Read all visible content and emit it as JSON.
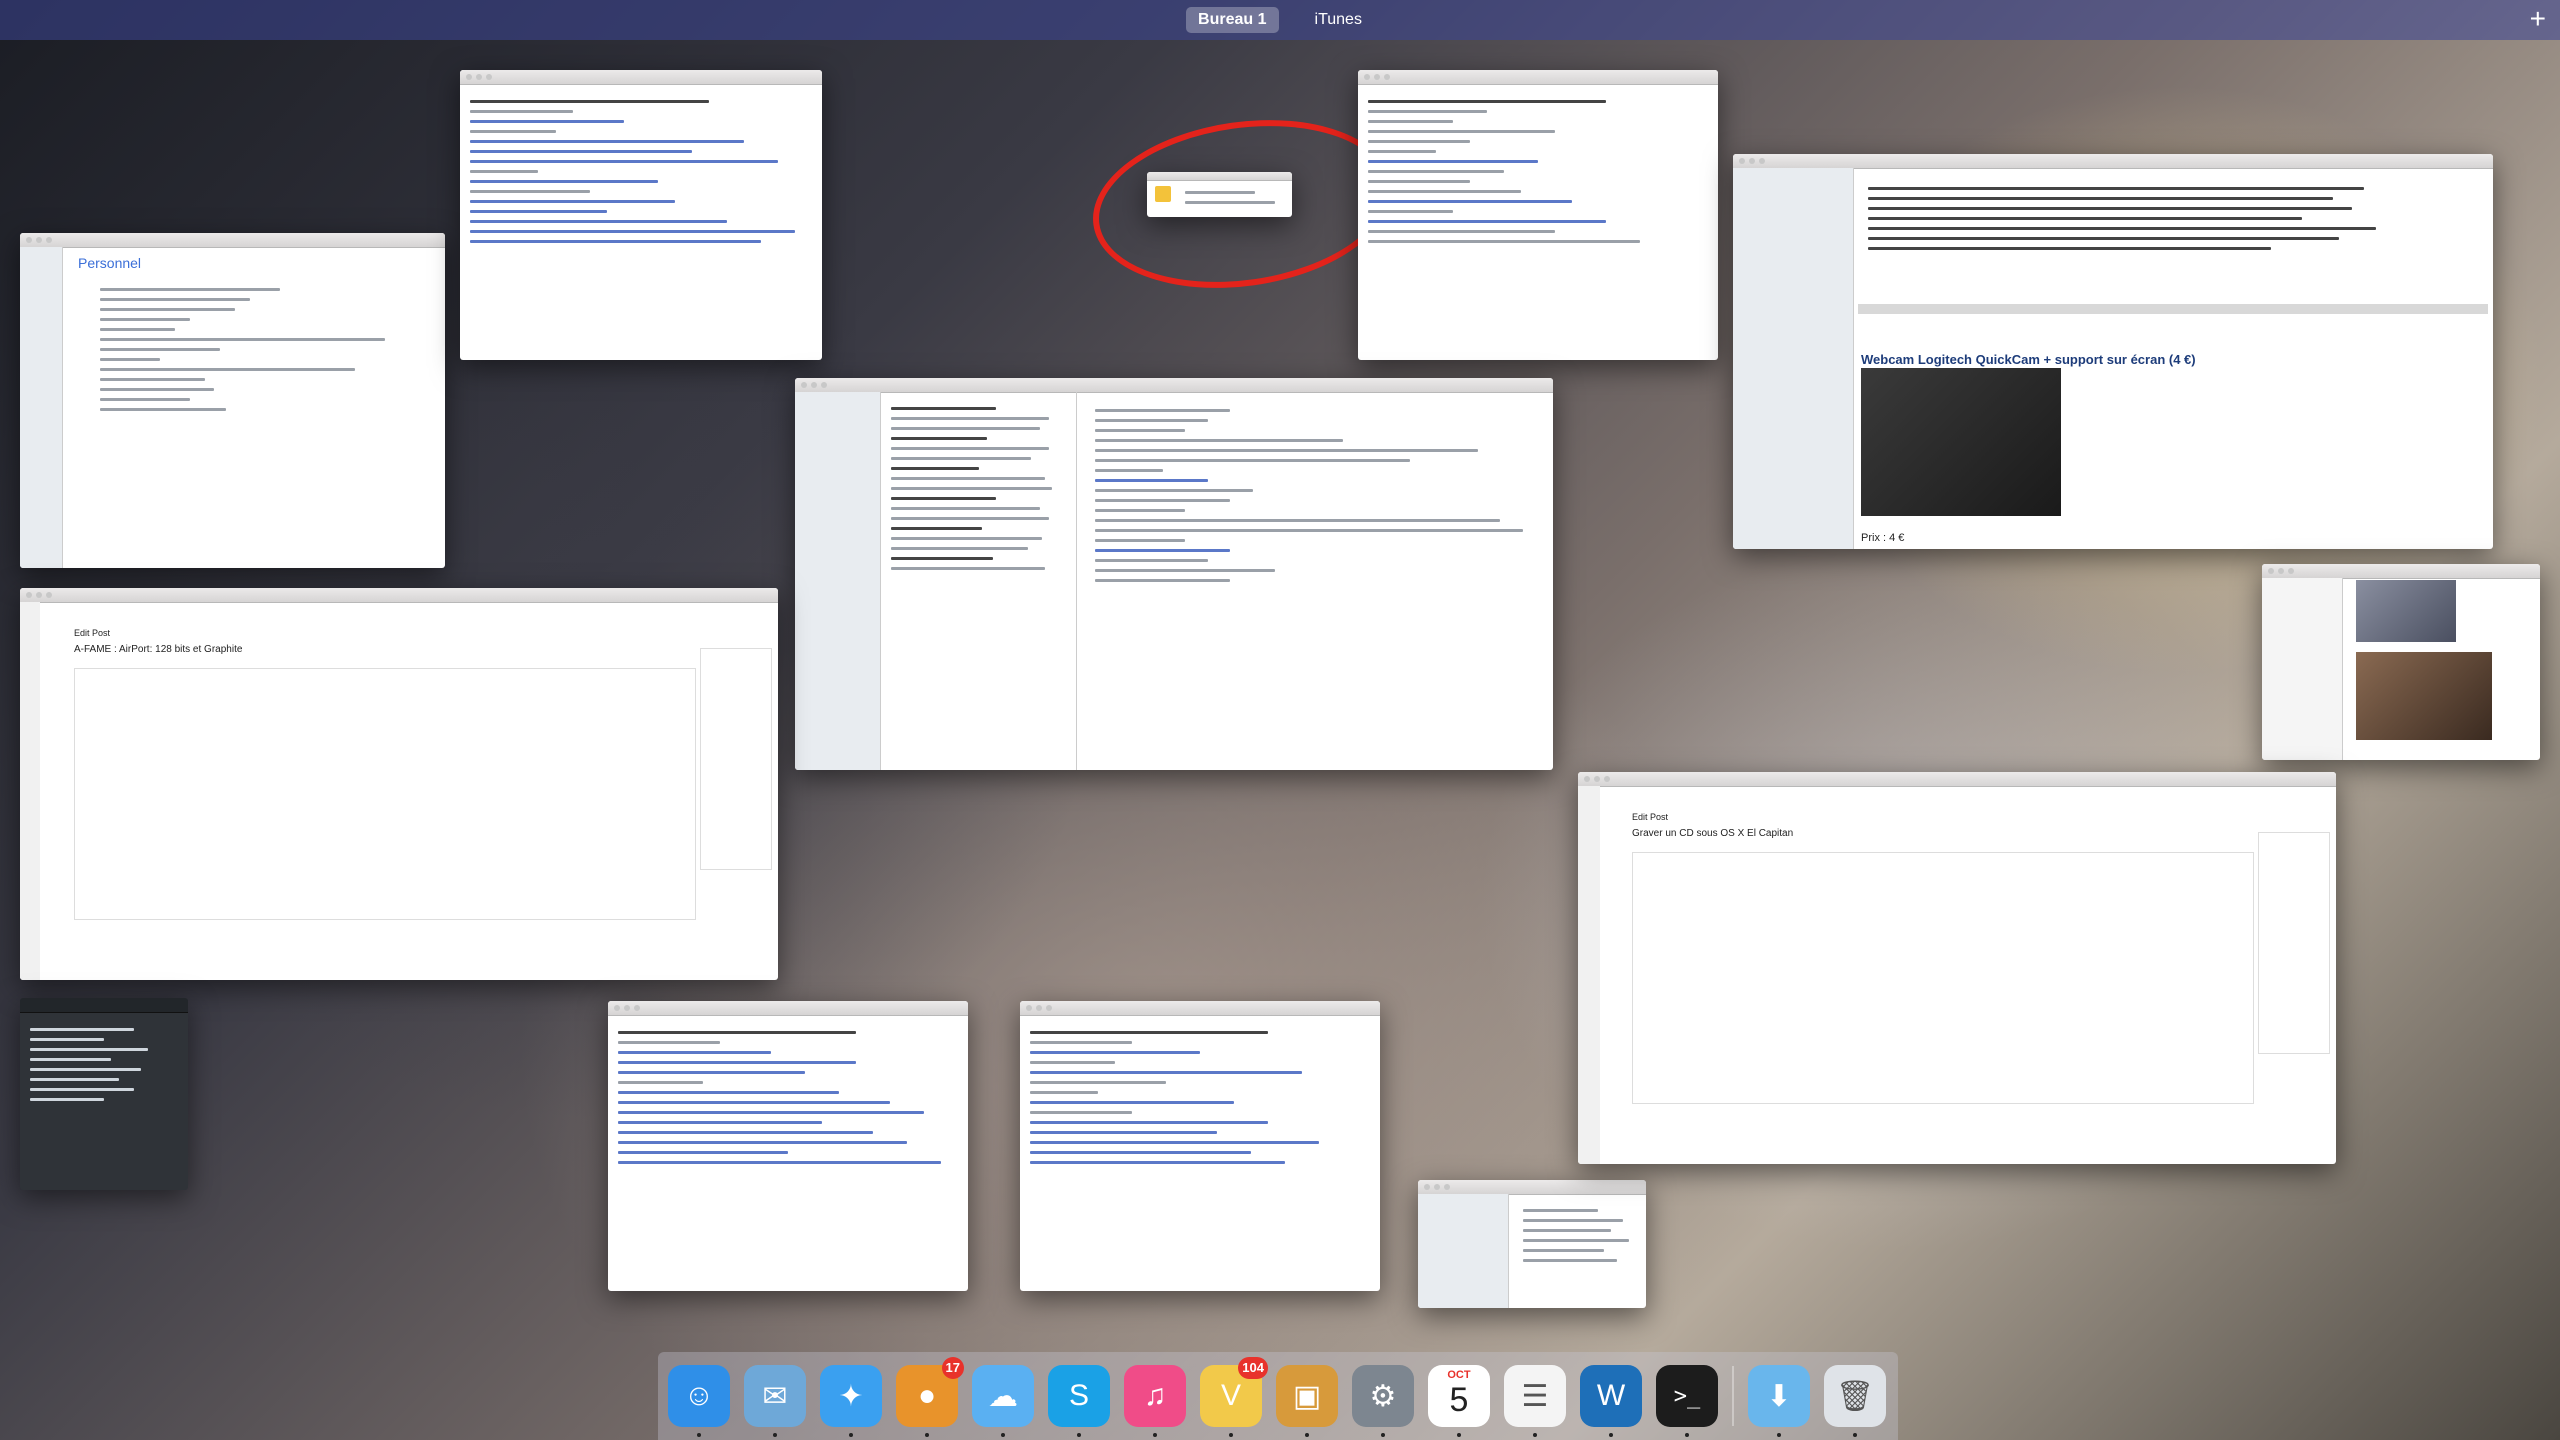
{
  "spaces": {
    "items": [
      {
        "label": "Bureau 1",
        "active": true
      },
      {
        "label": "iTunes",
        "active": false
      }
    ],
    "add_label": "+"
  },
  "windows": {
    "personnel_title": "Personnel",
    "edit_post_left": {
      "header": "Edit Post",
      "post_title": "A-FAME : AirPort: 128 bits et Graphite"
    },
    "edit_post_right": {
      "header": "Edit Post",
      "post_title": "Graver un CD sous OS X El Capitan"
    },
    "store_heading": "Webcam Logitech QuickCam + support sur écran (4 €)",
    "store_price": "Prix : 4 €"
  },
  "dock": {
    "items": [
      {
        "name": "finder-icon",
        "color": "#2f8fe8",
        "glyph": "☺"
      },
      {
        "name": "mail-stamp-icon",
        "color": "#6ea8d8",
        "glyph": "✉"
      },
      {
        "name": "safari-icon",
        "color": "#3aa0f0",
        "glyph": "✦"
      },
      {
        "name": "growl-icon",
        "color": "#e8932b",
        "glyph": "●",
        "badge": "17"
      },
      {
        "name": "messages-icon",
        "color": "#5ab0f2",
        "glyph": "☁"
      },
      {
        "name": "skype-icon",
        "color": "#1aa1e6",
        "glyph": "S"
      },
      {
        "name": "itunes-icon",
        "color": "#f04c88",
        "glyph": "♫"
      },
      {
        "name": "vip-icon",
        "color": "#f2c94a",
        "glyph": "V",
        "badge": "104"
      },
      {
        "name": "photo-preview-icon",
        "color": "#d79a3b",
        "glyph": "▣"
      },
      {
        "name": "system-preferences-icon",
        "color": "#7d8690",
        "glyph": "⚙"
      },
      {
        "name": "calendar-icon",
        "color": "#ffffff",
        "glyph": "",
        "calendar": true,
        "month": "OCT",
        "day": "5"
      },
      {
        "name": "reminders-icon",
        "color": "#f4f4f4",
        "glyph": "☰"
      },
      {
        "name": "ftp-icon",
        "color": "#1e6fb8",
        "glyph": "W"
      },
      {
        "name": "terminal-icon",
        "color": "#1c1c1c",
        "glyph": ">_"
      }
    ],
    "right_items": [
      {
        "name": "downloads-folder-icon",
        "color": "#69b6ec",
        "glyph": "⬇"
      },
      {
        "name": "trash-icon",
        "color": "#dfe3e8",
        "glyph": "🗑"
      }
    ]
  }
}
